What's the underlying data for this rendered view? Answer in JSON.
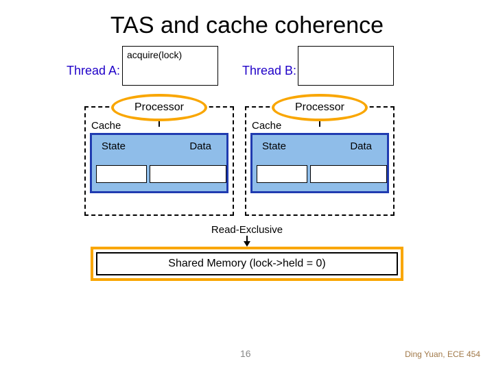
{
  "title": "TAS and cache coherence",
  "threadA": {
    "label": "Thread A:",
    "code": "acquire(lock)"
  },
  "threadB": {
    "label": "Thread B:",
    "code": ""
  },
  "cpuA": {
    "processor": "Processor",
    "cache_label": "Cache",
    "state_label": "State",
    "data_label": "Data",
    "state_value": "",
    "data_value": ""
  },
  "cpuB": {
    "processor": "Processor",
    "cache_label": "Cache",
    "state_label": "State",
    "data_label": "Data",
    "state_value": "",
    "data_value": ""
  },
  "read_exclusive": "Read-Exclusive",
  "memory": "Shared Memory (lock->held = 0)",
  "page_number": "16",
  "footer": "Ding Yuan, ECE 454"
}
